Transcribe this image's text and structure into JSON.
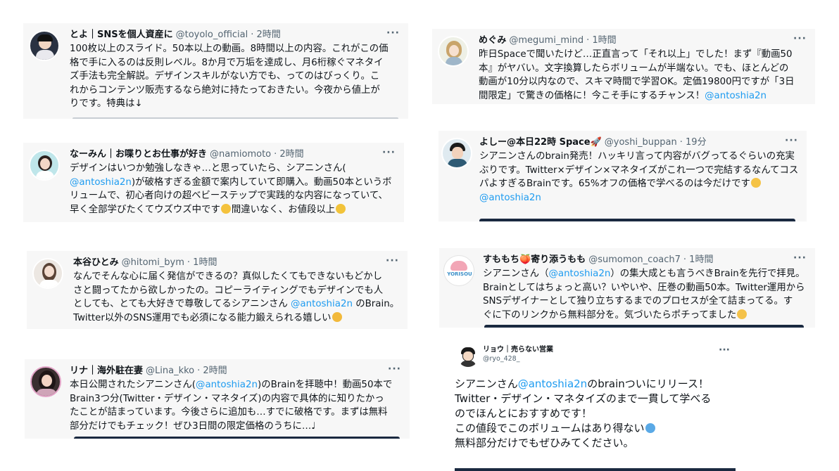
{
  "tweets": [
    {
      "name": "とよ｜SNSを個人資産に",
      "handle": "@toyolo_official",
      "time": "· 2時間",
      "avatar_icon": "person-avatar-icon",
      "lines": [
        [
          {
            "t": "100枚以上のスライド。50本以上の動画。8時間以上の内容。これがこの価"
          }
        ],
        [
          {
            "t": "格で手に入るのは反則レベル。8か月で万垢を達成し、月6桁稼ぐマネタイ"
          }
        ],
        [
          {
            "t": "ズ手法も完全解説。デザインスキルがない方でも、ってのはびっくり。こ"
          }
        ],
        [
          {
            "t": "れからコンテンツ販売するなら絶対に持たっておきたい。今夜から値上が"
          }
        ],
        [
          {
            "t": "りです。特典は↓"
          }
        ]
      ]
    },
    {
      "name": "めぐみ",
      "handle": "@megumi_mind",
      "time": "· 1時間",
      "avatar_icon": "illustrated-woman-avatar-icon",
      "lines": [
        [
          {
            "t": "昨日Spaceで聞いたけど…正直言って「それ以上」でした！まず『動画50"
          }
        ],
        [
          {
            "t": "本』がヤバい。文字換算したらボリュームが半端ない。でも、ほとんどの"
          }
        ],
        [
          {
            "t": "動画が10分以内なので、スキマ時間で学習OK。定価19800円ですが「3日"
          }
        ],
        [
          {
            "t": "間限定」で驚きの価格に！今こそ手にするチャンス！"
          },
          {
            "t": "@antoshia2n",
            "m": true
          }
        ]
      ]
    },
    {
      "name": "なーみん｜お喋りとお仕事が好き",
      "handle": "@namiomoto",
      "time": "· 2時間",
      "avatar_icon": "woman-avatar-icon",
      "lines": [
        [
          {
            "t": "デザインはいつか勉強しなきゃ…と思っていたら、シアニンさん("
          }
        ],
        [
          {
            "t": "@antoshia2n",
            "m": true
          },
          {
            "t": ")が破格すぎる金額で案内していて即購入。動画50本というボ"
          }
        ],
        [
          {
            "t": "リュームで、初心者向けの超ベビーステップで実践的な内容になっていて、"
          }
        ],
        [
          {
            "t": "早く全部学びたくてウズウズ中です"
          },
          {
            "e": "sparkles-emoji",
            "c": "#f4c23d"
          },
          {
            "t": "間違いなく、お値段以上"
          },
          {
            "e": "smiling-face-emoji",
            "c": "#f2c33a"
          }
        ]
      ]
    },
    {
      "name": "よしー@本日22時 Space🚀",
      "handle": "@yoshi_buppan",
      "time": "· 19分",
      "avatar_icon": "illustrated-man-avatar-icon",
      "lines": [
        [
          {
            "t": "シアニンさんのbrain発売！ハッキリ言って内容がバグってるぐらいの充実"
          }
        ],
        [
          {
            "t": "ぶりです。Twitter×デザイン×マネタイズがこれ一つで完結するなんてコス"
          }
        ],
        [
          {
            "t": "パよすぎるBrainです。65%オフの価格で学べるのは今だけです"
          },
          {
            "e": "thumbs-up-emoji",
            "c": "#f5c346"
          }
        ],
        [
          {
            "t": " "
          }
        ],
        [
          {
            "t": "@antoshia2n",
            "m": true
          }
        ]
      ]
    },
    {
      "name": "本谷ひとみ",
      "handle": "@hitomi_bym",
      "time": "· 1時間",
      "avatar_icon": "woman-avatar-icon",
      "lines": [
        [
          {
            "t": "なんでそんな心に届く発信ができるの？真似したくてもできないもどかし"
          }
        ],
        [
          {
            "t": "さと闘ってたから欲しかったの。コピーライティングでもデザインでも人"
          }
        ],
        [
          {
            "t": "としても、とても大好きで尊敬してるシアニンさん "
          },
          {
            "t": "@antoshia2n",
            "m": true
          },
          {
            "t": " のBrain。"
          }
        ],
        [
          {
            "t": "Twitter以外のSNS運用でも必須になる能力鍛えられる嬉しい"
          },
          {
            "e": "crying-face-emoji",
            "c": "#f2b93b"
          }
        ]
      ]
    },
    {
      "name": "すももち🍑寄り添うもも",
      "handle": "@sumomon_coach7",
      "time": "· 1時間",
      "avatar_icon": "yorisou-logo-avatar-icon",
      "lines": [
        [
          {
            "t": "シアニンさん（"
          },
          {
            "t": "@antoshia2n",
            "m": true
          },
          {
            "t": "）の集大成とも言うべきBrainを先行で拝見。"
          }
        ],
        [
          {
            "t": "Brainとしてはちょっと高い？いやいや、圧巻の動画50本。Twitter運用から"
          }
        ],
        [
          {
            "t": "SNSデザイナーとして独り立ちするまでのプロセスが全て詰まってる。す"
          }
        ],
        [
          {
            "t": "ぐに下のリンクから無料部分を。気づいたらポチってました"
          },
          {
            "e": "pointing-up-emoji",
            "c": "#f4c24a"
          }
        ]
      ]
    },
    {
      "name": "リナ｜海外駐在妻",
      "handle": "@Lina_kko",
      "time": "· 2時間",
      "avatar_icon": "woman-avatar-icon",
      "lines": [
        [
          {
            "t": "本日公開されたシアニンさん("
          },
          {
            "t": "@antoshia2n",
            "m": true
          },
          {
            "t": ")のBrainを拝聴中！動画50本で"
          }
        ],
        [
          {
            "t": "Brain3つ分(Twitter・デザイン・マネタイズ)の内容で具体的に知りたかっ"
          }
        ],
        [
          {
            "t": "たことが詰まっています。今後さらに追加も…すでに破格です。まずは無料"
          }
        ],
        [
          {
            "t": "部分だけでもチェック！ぜひ3日間の限定価格のうちに…♩"
          }
        ]
      ]
    },
    {
      "name": "リョウ｜売らない営業",
      "handle": "@ryo_428_",
      "avatar_icon": "illustrated-man-avatar-icon",
      "lines": [
        [
          {
            "t": "シアニンさん"
          },
          {
            "t": "@antoshia2n",
            "m": true
          },
          {
            "t": "のbrainついにリリース！"
          }
        ],
        [
          {
            "t": "Twitter・デザイン・マネタイズのまで一貫して学べる"
          }
        ],
        [
          {
            "t": "のでほんとにおすすめです！"
          }
        ],
        [
          {
            "t": "この値段でこのボリュームはあり得ない"
          },
          {
            "e": "sweat-droplets-emoji",
            "c": "#5aa9e6"
          }
        ],
        [
          {
            "t": "無料部分だけでもぜひみてください。"
          }
        ]
      ]
    }
  ],
  "more_label": "···"
}
